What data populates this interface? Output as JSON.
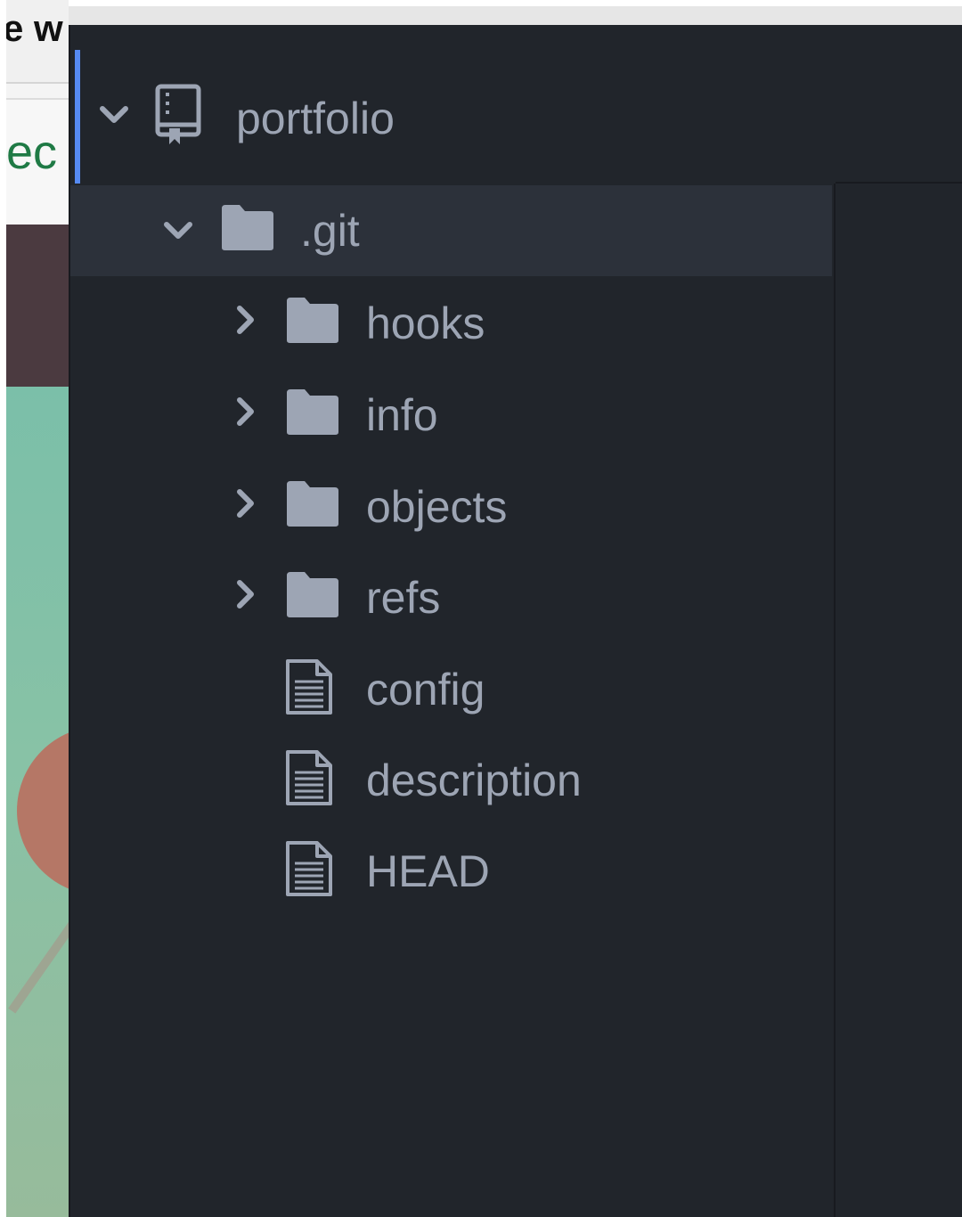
{
  "background_window": {
    "top_text": "e w",
    "mid_text": "ec"
  },
  "tree": {
    "root": {
      "label": "portfolio",
      "icon": "repo-icon",
      "expanded": true
    },
    "git": {
      "label": ".git",
      "icon": "folder-icon",
      "expanded": true
    },
    "children": [
      {
        "label": "hooks",
        "type": "folder",
        "icon": "folder-icon"
      },
      {
        "label": "info",
        "type": "folder",
        "icon": "folder-icon"
      },
      {
        "label": "objects",
        "type": "folder",
        "icon": "folder-icon"
      },
      {
        "label": "refs",
        "type": "folder",
        "icon": "folder-icon"
      },
      {
        "label": "config",
        "type": "file",
        "icon": "file-text-icon"
      },
      {
        "label": "description",
        "type": "file",
        "icon": "file-text-icon"
      },
      {
        "label": "HEAD",
        "type": "file",
        "icon": "file-text-icon"
      }
    ]
  },
  "colors": {
    "panel_bg": "#21252b",
    "selected_row": "#2c313a",
    "text": "#9da5b4",
    "accent": "#568af2"
  }
}
